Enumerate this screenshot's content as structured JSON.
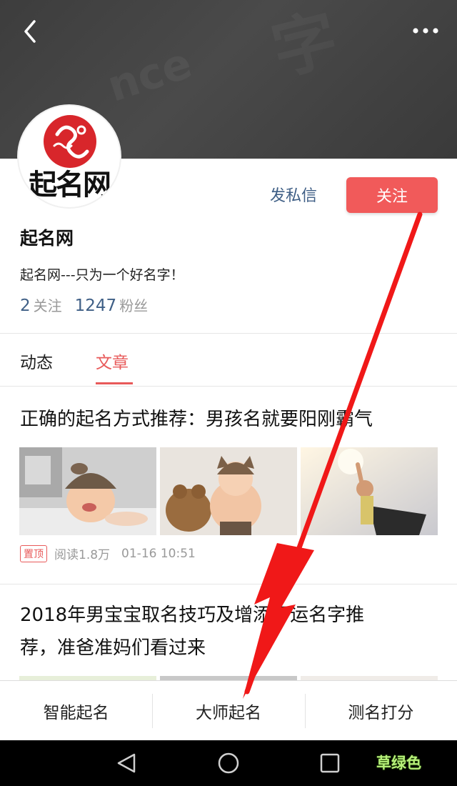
{
  "header": {
    "back_icon": "chevron-left-icon",
    "more_icon": "more-horizontal-icon"
  },
  "profile": {
    "avatar_logo_text": "起名网",
    "name": "起名网",
    "bio": "起名网---只为一个好名字！",
    "following_count": "2",
    "following_label": "关注",
    "followers_count": "1247",
    "followers_label": "粉丝",
    "message_label": "发私信",
    "follow_label": "关注",
    "accent_color": "#f15a5a",
    "link_color": "#3f5f86"
  },
  "tabs": [
    {
      "label": "动态",
      "active": false
    },
    {
      "label": "文章",
      "active": true
    }
  ],
  "articles": [
    {
      "title": "正确的起名方式推荐：男孩名就要阳刚霸气",
      "pinned_label": "置顶",
      "reads": "阅读1.8万",
      "time": "01-16 10:51"
    },
    {
      "title_line1": "2018年男宝宝取名技巧及增添好运名字推",
      "title_line2": "荐，准爸准妈们看过来"
    }
  ],
  "bottom_nav": [
    {
      "label": "智能起名"
    },
    {
      "label": "大师起名"
    },
    {
      "label": "测名打分"
    }
  ],
  "system_nav": {
    "back_icon": "triangle-back-icon",
    "home_icon": "circle-home-icon",
    "recents_icon": "square-recents-icon"
  },
  "watermark_text": "草绿色"
}
